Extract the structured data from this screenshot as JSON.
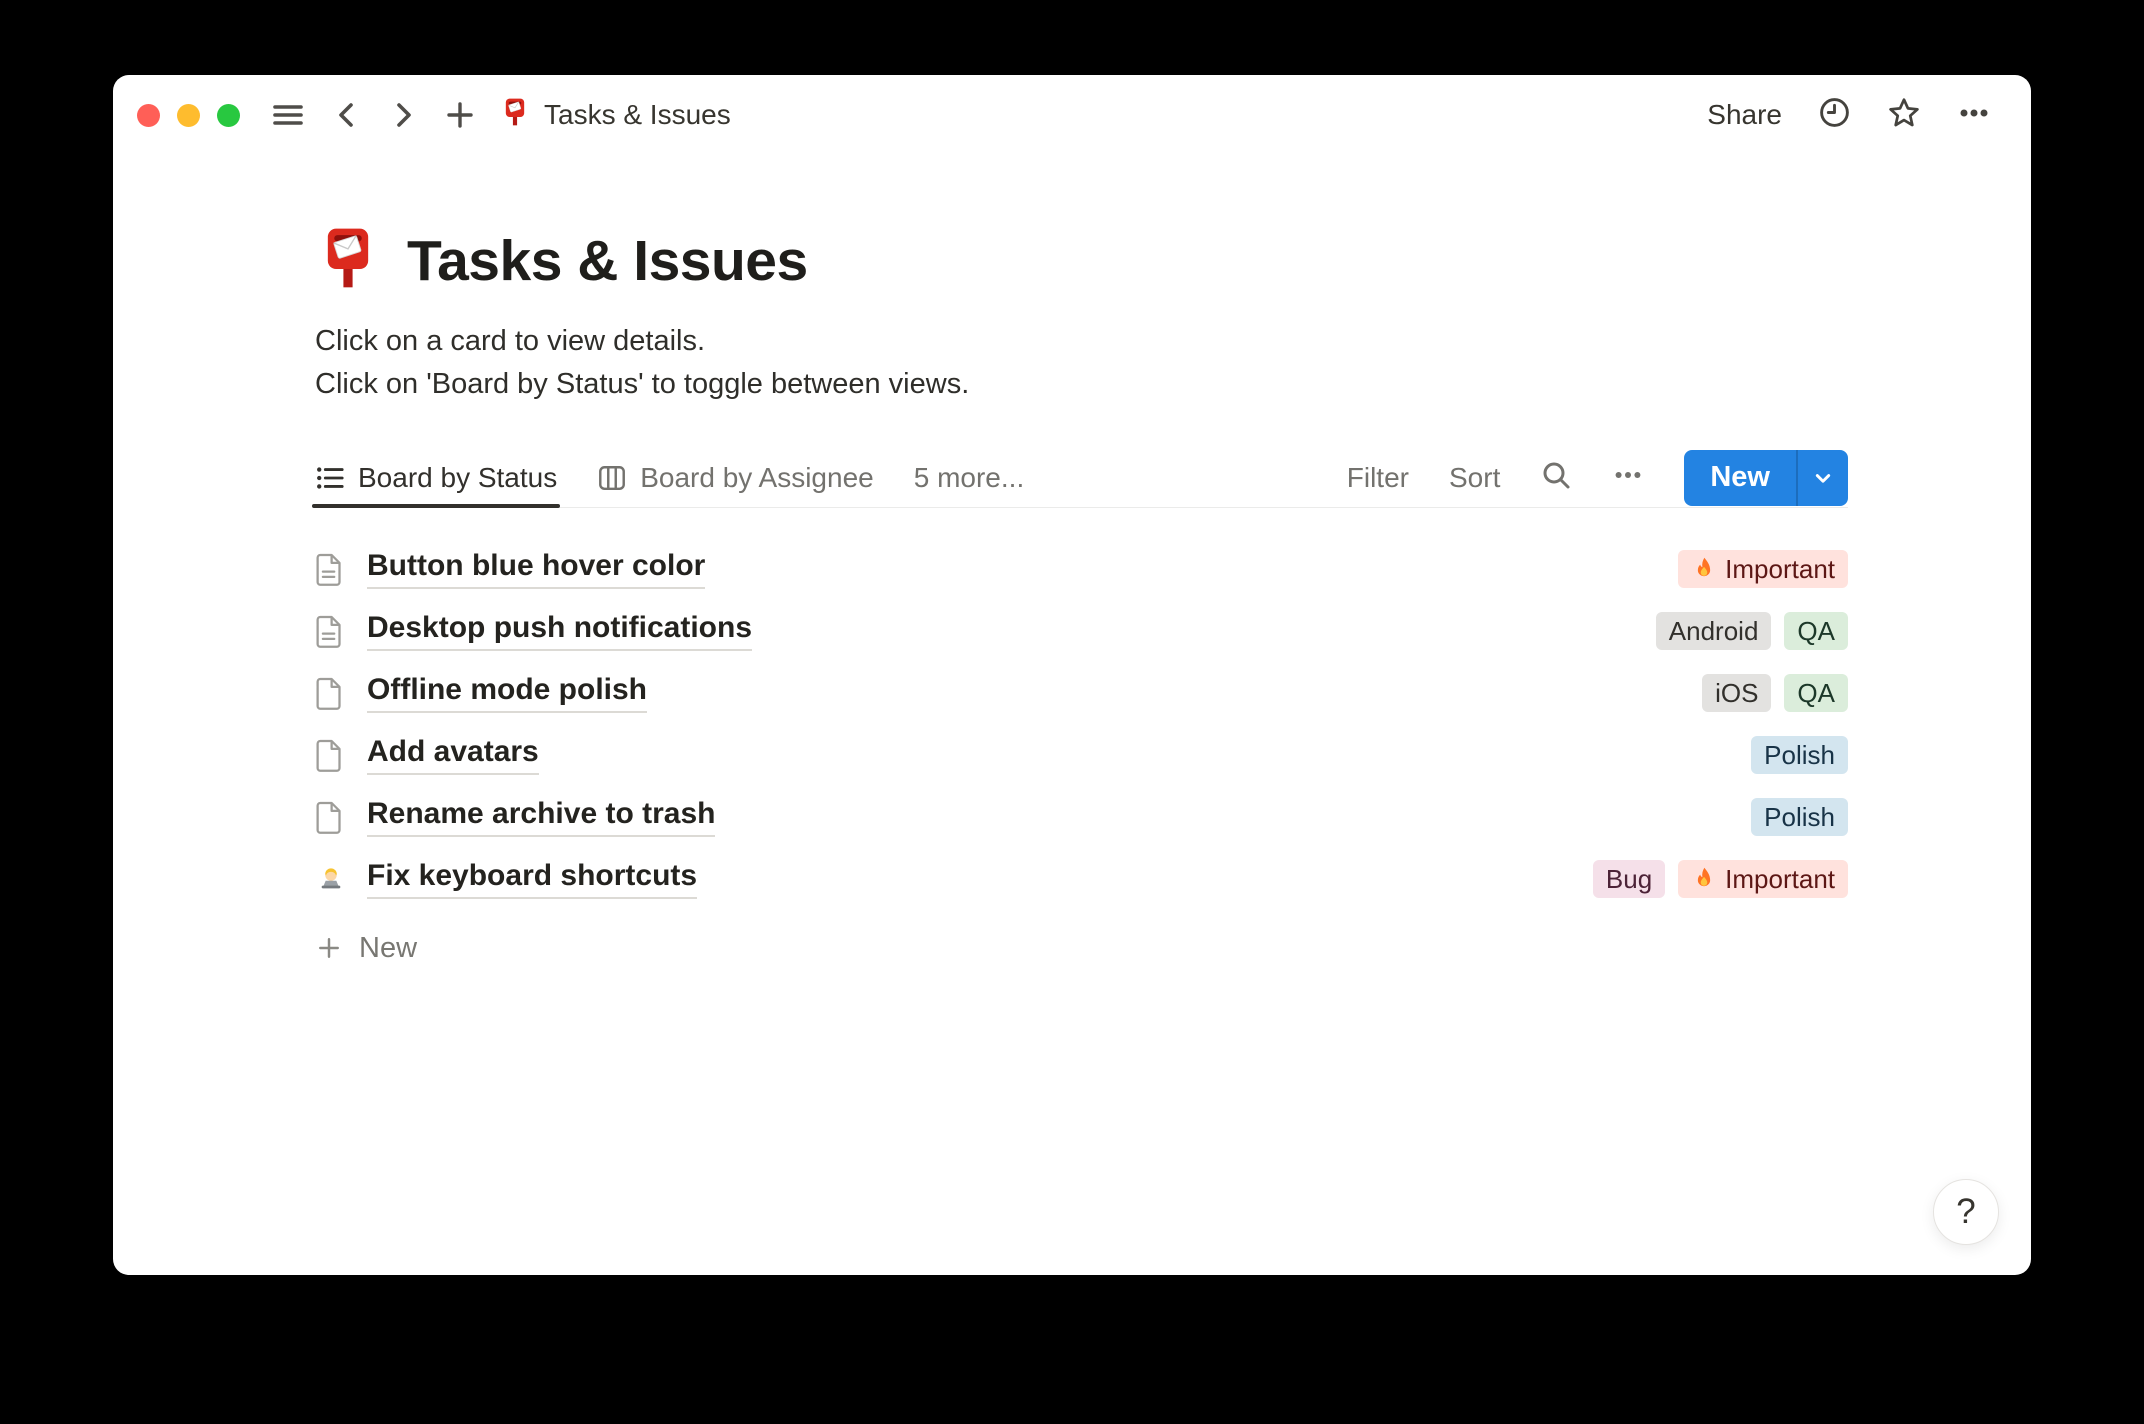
{
  "colors": {
    "accent_blue": "#2383e2",
    "tag_palette": {
      "red": {
        "bg": "#ffe2dd",
        "text": "#5d1715"
      },
      "gray": {
        "bg": "#e3e2e0",
        "text": "#32302c"
      },
      "green": {
        "bg": "#dbeddb",
        "text": "#1c3829"
      },
      "blue": {
        "bg": "#d3e5ef",
        "text": "#183347"
      },
      "pink": {
        "bg": "#f5e0e9",
        "text": "#4c2337"
      }
    }
  },
  "titlebar": {
    "doc_icon": "📮",
    "doc_title": "Tasks & Issues",
    "share_label": "Share"
  },
  "page": {
    "icon": "📮",
    "title": "Tasks & Issues",
    "description_line1": "Click on a card to view details.",
    "description_line2": "Click on 'Board by Status' to toggle between views."
  },
  "view_bar": {
    "tabs": [
      {
        "label": "Board by Status",
        "icon": "list-view-icon",
        "active": true
      },
      {
        "label": "Board by Assignee",
        "icon": "board-view-icon",
        "active": false
      }
    ],
    "more_label": "5 more...",
    "filter_label": "Filter",
    "sort_label": "Sort",
    "new_label": "New"
  },
  "tasks": [
    {
      "icon": "page-text-icon",
      "title": "Button blue hover color",
      "tags": [
        {
          "emoji": "🔥",
          "label": "Important",
          "color": "red"
        }
      ]
    },
    {
      "icon": "page-text-icon",
      "title": "Desktop push notifications",
      "tags": [
        {
          "label": "Android",
          "color": "gray"
        },
        {
          "label": "QA",
          "color": "green"
        }
      ]
    },
    {
      "icon": "page-blank-icon",
      "title": "Offline mode polish",
      "tags": [
        {
          "label": "iOS",
          "color": "gray"
        },
        {
          "label": "QA",
          "color": "green"
        }
      ]
    },
    {
      "icon": "page-blank-icon",
      "title": "Add avatars",
      "tags": [
        {
          "label": "Polish",
          "color": "blue"
        }
      ]
    },
    {
      "icon": "page-blank-icon",
      "title": "Rename archive to trash",
      "tags": [
        {
          "label": "Polish",
          "color": "blue"
        }
      ]
    },
    {
      "icon": "technologist-emoji",
      "emoji": "👨‍💻",
      "title": "Fix keyboard shortcuts",
      "tags": [
        {
          "label": "Bug",
          "color": "pink"
        },
        {
          "emoji": "🔥",
          "label": "Important",
          "color": "red"
        }
      ]
    }
  ],
  "list_footer": {
    "new_label": "New"
  },
  "help_button": {
    "label": "?"
  }
}
